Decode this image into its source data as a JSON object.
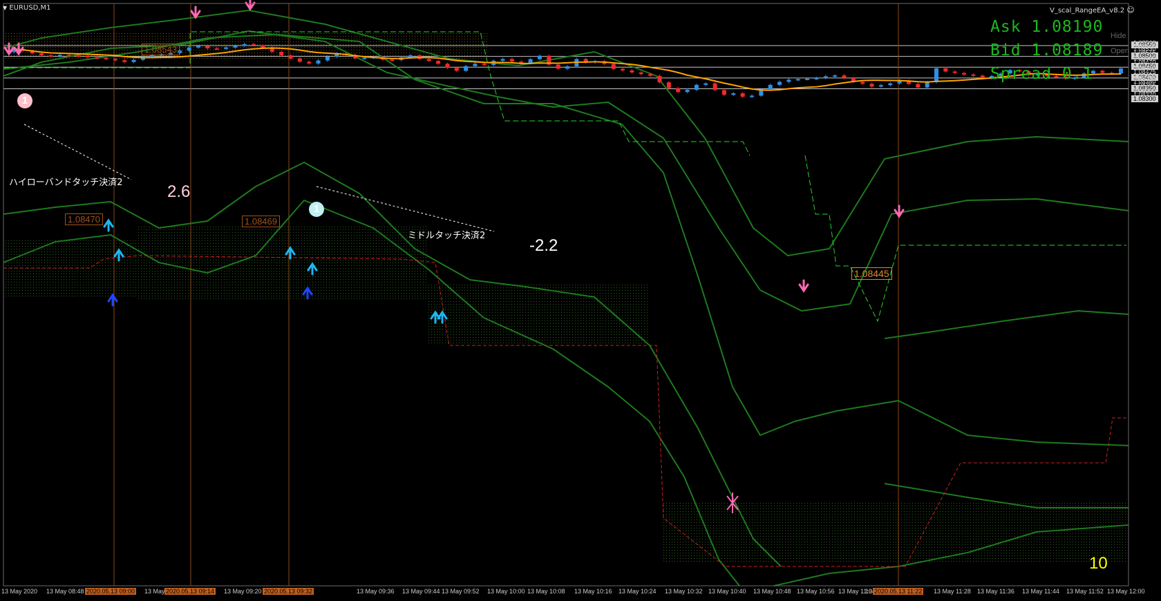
{
  "window": {
    "symbol_title": "EURUSD,M1",
    "ea_title": "V_scal_RangeEA_v8.2"
  },
  "quotes": {
    "ask": "Ask 1.08190",
    "bid": "Bid 1.08189",
    "spread": "Spread 0.1"
  },
  "buttons": {
    "hide": "Hide",
    "open": "Open"
  },
  "price_axis": {
    "labels": [
      {
        "text": "1.08560",
        "price": 1.0856
      },
      {
        "text": "1.08550",
        "price": 1.0855,
        "highlight": true
      },
      {
        "text": "1.08545",
        "price": 1.08545
      },
      {
        "text": "1.08530",
        "price": 1.0853
      },
      {
        "text": "1.08515",
        "price": 1.08515
      },
      {
        "text": "1.08500",
        "price": 1.085,
        "highlight": true
      },
      {
        "text": "1.08485",
        "price": 1.08485
      },
      {
        "text": "1.08470",
        "price": 1.0847
      },
      {
        "text": "1.08455",
        "price": 1.08455
      },
      {
        "text": "1.08450",
        "price": 1.0845,
        "highlight": true
      },
      {
        "text": "1.08440",
        "price": 1.0844
      },
      {
        "text": "1.08425",
        "price": 1.08425
      },
      {
        "text": "1.08410",
        "price": 1.0841
      },
      {
        "text": "1.08400",
        "price": 1.084,
        "highlight": true
      },
      {
        "text": "1.08395",
        "price": 1.08395
      },
      {
        "text": "1.08380",
        "price": 1.0838
      },
      {
        "text": "1.08365",
        "price": 1.08365
      },
      {
        "text": "1.08350",
        "price": 1.0835,
        "highlight": true
      },
      {
        "text": "1.08335",
        "price": 1.08335
      },
      {
        "text": "1.08320",
        "price": 1.0832
      },
      {
        "text": "1.08305",
        "price": 1.08305
      },
      {
        "text": "1.08300",
        "price": 1.083,
        "highlight": true
      }
    ]
  },
  "time_axis": {
    "labels": [
      {
        "text": "13 May 2020"
      },
      {
        "text": "13 May 08:48"
      },
      {
        "text": "2020.05.13 09:00",
        "highlight": true
      },
      {
        "text": "13 May 0"
      },
      {
        "text": "2020.05.13 09:14",
        "highlight": true
      },
      {
        "text": "13 May 09:20"
      },
      {
        "text": "2020.05.13 09:32",
        "highlight": true
      },
      {
        "text": "13 May 09:36"
      },
      {
        "text": "13 May 09:44"
      },
      {
        "text": "13 May 09:52"
      },
      {
        "text": "13 May 10:00"
      },
      {
        "text": "13 May 10:08"
      },
      {
        "text": "13 May 10:16"
      },
      {
        "text": "13 May 10:24"
      },
      {
        "text": "13 May 10:32"
      },
      {
        "text": "13 May 10:40"
      },
      {
        "text": "13 May 10:48"
      },
      {
        "text": "13 May 10:56"
      },
      {
        "text": "13 May 11:04"
      },
      {
        "text": "13 May 1"
      },
      {
        "text": "2020.05.13 11:22",
        "highlight": true
      },
      {
        "text": "13 May 11:28"
      },
      {
        "text": "13 May 11:36"
      },
      {
        "text": "13 May 11:44"
      },
      {
        "text": "13 May 11:52"
      },
      {
        "text": "13 May 12:00"
      }
    ]
  },
  "price_labels": [
    {
      "text": "1.08543"
    },
    {
      "text": "1.08470"
    },
    {
      "text": "1.08469"
    },
    {
      "text": "1.08445"
    }
  ],
  "annotations": {
    "hilo_exit": "ハイローバンドタッチ決済2",
    "middle_exit": "ミドルタッチ決済2",
    "profit_1": "2.6",
    "profit_2": "-2.2",
    "counter": "10",
    "order_mark_1": "1",
    "order_mark_2": "1"
  },
  "colors": {
    "background": "#000000",
    "bull_candle": "#2f8fe6",
    "bear_candle": "#f02a2a",
    "moving_average": "#ffa500",
    "bands": "#1e7a1e",
    "quote_text": "#1db81d",
    "sell_arrow": "#ff69b4",
    "buy_arrow": "#1fb5f0",
    "buy_arrow_dark": "#1f45ff",
    "counter_text": "#ffff00"
  },
  "chart_data": {
    "type": "candlestick",
    "symbol": "EURUSD",
    "timeframe": "M1",
    "ylim": [
      1.08297,
      1.08568
    ],
    "grid": false,
    "close_series": [
      1.08535,
      1.08526,
      1.08514,
      1.08505,
      1.08501,
      1.08507,
      1.08504,
      1.08502,
      1.08496,
      1.08493,
      1.08488,
      1.08482,
      1.08474,
      1.08484,
      1.08498,
      1.08506,
      1.0851,
      1.08516,
      1.08527,
      1.08541,
      1.08548,
      1.08537,
      1.08536,
      1.08541,
      1.08549,
      1.08557,
      1.08551,
      1.0854,
      1.08521,
      1.08505,
      1.0849,
      1.08475,
      1.08467,
      1.08481,
      1.08499,
      1.08513,
      1.08507,
      1.08491,
      1.08494,
      1.08497,
      1.08485,
      1.08483,
      1.08495,
      1.08505,
      1.08488,
      1.08479,
      1.08466,
      1.08447,
      1.08433,
      1.08455,
      1.08466,
      1.0846,
      1.0848,
      1.08488,
      1.08476,
      1.08469,
      1.08487,
      1.08503,
      1.08462,
      1.08443,
      1.08454,
      1.08488,
      1.08472,
      1.08478,
      1.08465,
      1.08442,
      1.08435,
      1.08426,
      1.08418,
      1.0841,
      1.0838,
      1.08353,
      1.08335,
      1.08345,
      1.08368,
      1.08375,
      1.08344,
      1.08322,
      1.08329,
      1.08313,
      1.08318,
      1.08348,
      1.08368,
      1.08382,
      1.08392,
      1.08395,
      1.08397,
      1.084,
      1.08408,
      1.08412,
      1.084,
      1.08382,
      1.08373,
      1.0836,
      1.08367,
      1.08375,
      1.08388,
      1.08372,
      1.08356,
      1.08381,
      1.08445,
      1.0843,
      1.08423,
      1.08416,
      1.08411,
      1.08399,
      1.08409,
      1.08421,
      1.08437,
      1.08431,
      1.08414,
      1.08418,
      1.08409,
      1.08407,
      1.08397,
      1.08402,
      1.08421,
      1.08433,
      1.08424,
      1.08421,
      1.08444
    ]
  }
}
